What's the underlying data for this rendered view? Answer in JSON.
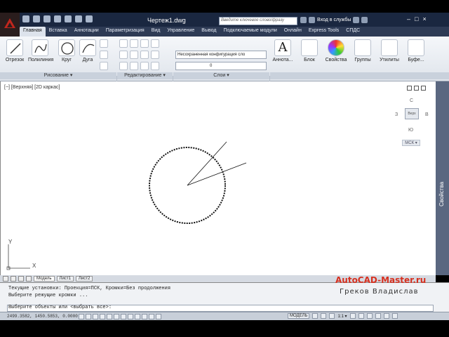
{
  "window": {
    "title": "Чертеж1.dwg",
    "search_placeholder": "Введите ключевое слово/фразу",
    "signin_label": "Вход в службы"
  },
  "tabs": [
    "Главная",
    "Вставка",
    "Аннотации",
    "Параметризация",
    "Вид",
    "Управление",
    "Вывод",
    "Подключаемые модули",
    "Онлайн",
    "Express Tools",
    "СПДС"
  ],
  "ribbon": {
    "draw": {
      "tools": [
        "Отрезок",
        "Полилиния",
        "Круг",
        "Дуга"
      ],
      "panel_label": "Рисование ▾"
    },
    "modify": {
      "panel_label": "Редактирование ▾"
    },
    "layers": {
      "layer_state": "Несохраненная конфигурация сло",
      "current_layer": "0",
      "panel_label": "Слои ▾"
    },
    "annotation": {
      "label": "Аннота..."
    },
    "block": {
      "label": "Блок"
    },
    "properties": {
      "label": "Свойства"
    },
    "groups": {
      "label": "Группы"
    },
    "utilities": {
      "label": "Утилиты"
    },
    "clipboard": {
      "label": "Буфе..."
    }
  },
  "viewport": {
    "label": "[−] [Верхняя] [2D каркас]",
    "viewcube": {
      "north": "С",
      "south": "Ю",
      "west": "З",
      "east": "В",
      "face": "Верх"
    },
    "wcs": "МСК ▾"
  },
  "side_palette": {
    "label": "Свойства"
  },
  "ucs": {
    "x": "X",
    "y": "Y"
  },
  "layout_tabs": [
    "Модель",
    "Лист1",
    "Лист2"
  ],
  "command": {
    "history": [
      "Текущие установки: Проекция=ПСК, Кромки=Без продолжения",
      "Выберите режущие кромки ..."
    ],
    "prompt": "Выберите объекты или <выбрать все>:"
  },
  "watermark": "AutoCAD-Master.ru",
  "author": "Греков Владислав",
  "status": {
    "coordinates": "2499.3582, 1450.5853, 0.0000",
    "model_label": "МОДЕЛЬ",
    "scale": "1:1 ▾"
  },
  "colors": {
    "title_bar": "#1a2740",
    "ribbon_tabs": "#2e3b55",
    "watermark": "#d6301f",
    "canvas": "#ffffff"
  }
}
